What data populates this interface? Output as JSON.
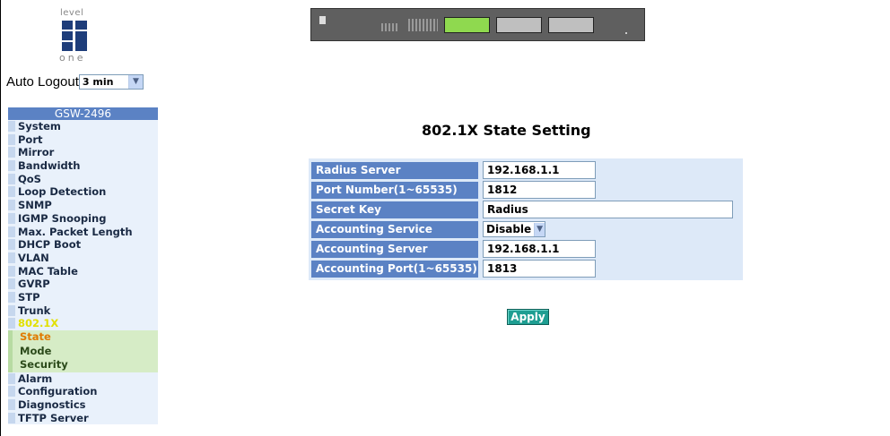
{
  "logo": {
    "top_text": "level",
    "bottom_text": "one"
  },
  "auto_logout": {
    "label": "Auto Logout",
    "selected": "3 min"
  },
  "menu": {
    "header": "GSW-2496",
    "items_before": [
      "System",
      "Port",
      "Mirror",
      "Bandwidth",
      "QoS",
      "Loop Detection",
      "SNMP",
      "IGMP Snooping",
      "Max. Packet Length",
      "DHCP Boot",
      "VLAN",
      "MAC Table",
      "GVRP",
      "STP",
      "Trunk"
    ],
    "active_item": "802.1X",
    "sub_items": [
      "State",
      "Mode",
      "Security"
    ],
    "items_after": [
      "Alarm",
      "Configuration",
      "Diagnostics",
      "TFTP Server"
    ]
  },
  "page": {
    "title": "802.1X State Setting"
  },
  "form": {
    "radius_server": {
      "label": "Radius Server",
      "value": "192.168.1.1"
    },
    "port_number": {
      "label": "Port Number(1~65535)",
      "value": "1812"
    },
    "secret_key": {
      "label": "Secret Key",
      "value": "Radius"
    },
    "accounting_service": {
      "label": "Accounting Service",
      "value": "Disable"
    },
    "accounting_server": {
      "label": "Accounting Server",
      "value": "192.168.1.1"
    },
    "accounting_port": {
      "label": "Accounting Port(1~65535)",
      "value": "1813"
    }
  },
  "apply_label": "Apply",
  "colors": {
    "label_bg": "#5b82c4",
    "form_bg": "#dde9f8",
    "apply_bg": "#1e9e92",
    "active_menu": "#e2e000",
    "current_sub": "#e07a00"
  }
}
